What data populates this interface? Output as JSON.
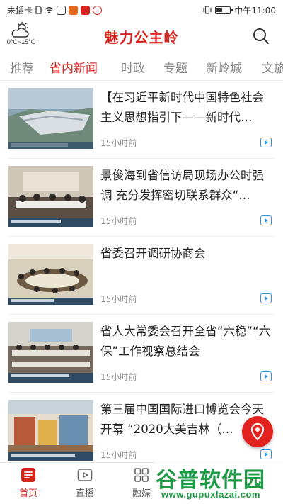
{
  "status_bar": {
    "carrier": "未插卡",
    "time": "中午11:00"
  },
  "header": {
    "title": "魅力公主岭",
    "weather": {
      "icon": "partly-cloudy-icon",
      "temperature": "0°C~15°C"
    }
  },
  "tabs": [
    {
      "label": "推荐",
      "active": false
    },
    {
      "label": "省内新闻",
      "active": true
    },
    {
      "label": "时政",
      "active": false
    },
    {
      "label": "专题",
      "active": false
    },
    {
      "label": "新岭城",
      "active": false
    },
    {
      "label": "文旅",
      "active": false
    }
  ],
  "news": [
    {
      "title": "【在习近平新时代中国特色社会主义思想指引下——新时代…",
      "time": "15小时前",
      "has_video": true
    },
    {
      "title": "景俊海到省信访局现场办公时强调 充分发挥密切联系群众“…",
      "time": "15小时前",
      "has_video": true
    },
    {
      "title": "省委召开调研协商会",
      "time": "15小时前",
      "has_video": true
    },
    {
      "title": "省人大常委会召开全省“六稳”“六保”工作视察总结会",
      "time": "15小时前",
      "has_video": true
    },
    {
      "title": "第三届中国国际进口博览会今天开幕 “2020大美吉林（…",
      "time": "15小时前",
      "has_video": true
    }
  ],
  "bottom_nav": [
    {
      "label": "首页",
      "icon": "home-news-icon",
      "active": true
    },
    {
      "label": "直播",
      "icon": "live-play-icon",
      "active": false
    },
    {
      "label": "融媒",
      "icon": "grid-icon",
      "active": false
    }
  ],
  "watermark": {
    "main": "谷普软件园",
    "url": "www.gupuxlazai.com"
  },
  "colors": {
    "accent": "#d8231f",
    "video": "#3a8fd6",
    "watermark": "#1f9a46"
  }
}
